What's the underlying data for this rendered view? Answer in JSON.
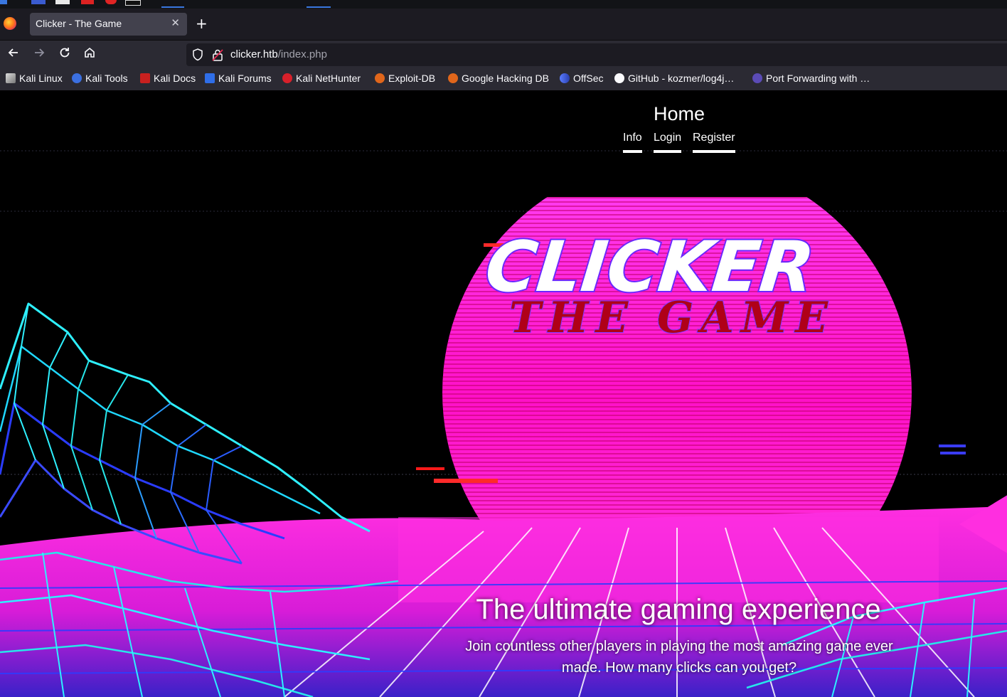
{
  "browser": {
    "tab_title": "Clicker - The Game",
    "new_tab": "+",
    "url_host": "clicker.htb",
    "url_path": "/index.php",
    "bookmarks": [
      {
        "label": "Kali Linux",
        "icon": "kali-dragon-icon"
      },
      {
        "label": "Kali Tools",
        "icon": "kali-tools-icon"
      },
      {
        "label": "Kali Docs",
        "icon": "kali-docs-icon"
      },
      {
        "label": "Kali Forums",
        "icon": "kali-forums-icon"
      },
      {
        "label": "Kali NetHunter",
        "icon": "nethunter-icon"
      },
      {
        "label": "Exploit-DB",
        "icon": "exploit-db-icon"
      },
      {
        "label": "Google Hacking DB",
        "icon": "ghdb-icon"
      },
      {
        "label": "OffSec",
        "icon": "offsec-icon"
      },
      {
        "label": "GitHub - kozmer/log4j…",
        "icon": "github-icon"
      },
      {
        "label": "Port Forwarding with …",
        "icon": "bug-icon"
      }
    ]
  },
  "site": {
    "nav_title": "Home",
    "nav_links": [
      "Info",
      "Login",
      "Register"
    ],
    "logo_main": "CLICKER",
    "logo_sub": "THE GAME",
    "headline": "The ultimate gaming experience",
    "lead": "Join countless other players in playing the most amazing game ever made. How many clicks can you get?"
  },
  "colors": {
    "browser_chrome": "#2b2a33",
    "tab_active": "#42414d",
    "sun_magenta": "#ff1fd6",
    "grid_cyan": "#27e6ea",
    "grid_blue": "#2a3cff",
    "logo_red": "#b00018"
  }
}
